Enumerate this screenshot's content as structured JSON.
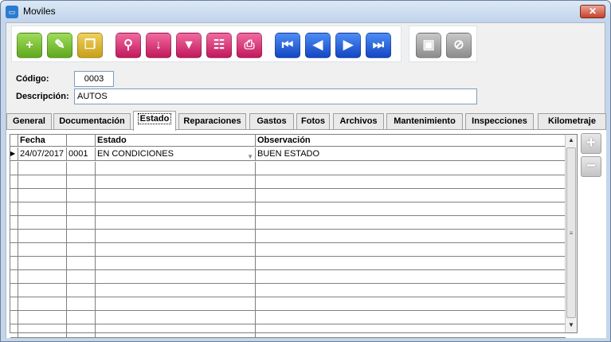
{
  "window": {
    "title": "Moviles",
    "close": "✕"
  },
  "form": {
    "codigo_label": "Código:",
    "codigo_value": "0003",
    "descripcion_label": "Descripción:",
    "descripcion_value": "AUTOS"
  },
  "tabs": [
    "General",
    "Documentación",
    "Estado",
    "Reparaciones",
    "Gastos",
    "Fotos",
    "Archivos",
    "Mantenimiento",
    "Inspecciones",
    "Kilometraje"
  ],
  "active_tab": "Estado",
  "grid": {
    "columns": [
      "Fecha",
      "",
      "Estado",
      "Observación"
    ],
    "rows": [
      {
        "indicator": "▶",
        "fecha": "24/07/2017",
        "codigo": "0001",
        "estado": "EN CONDICIONES",
        "observacion": "BUEN ESTADO"
      }
    ]
  },
  "toolbar_icons": [
    "add-icon",
    "edit-icon",
    "duplicate-icon",
    "search-icon",
    "sort-icon",
    "filter-icon",
    "report-icon",
    "print-icon",
    "first-icon",
    "previous-icon",
    "next-icon",
    "last-icon",
    "save-icon",
    "cancel-icon"
  ],
  "side_buttons": {
    "add": "+",
    "remove": "−"
  },
  "scroll": {
    "up": "▲",
    "down": "▼",
    "thumb": "≡"
  }
}
